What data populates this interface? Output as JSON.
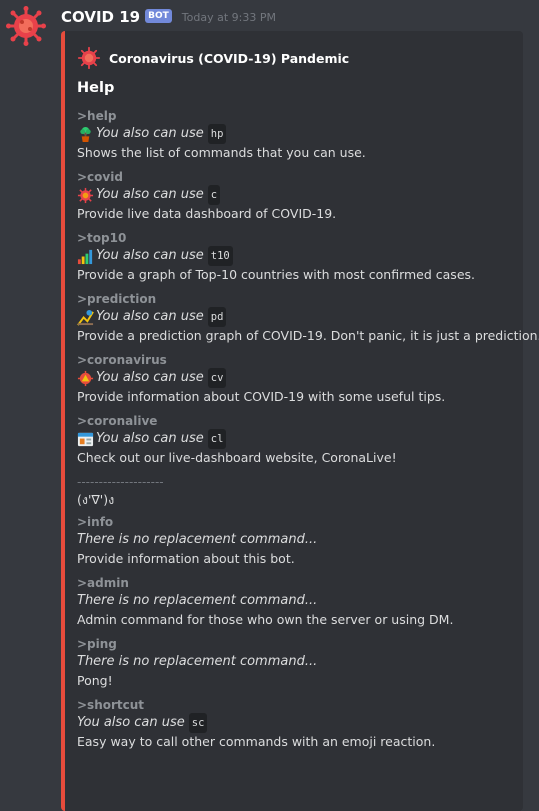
{
  "message": {
    "username": "COVID 19",
    "bot_tag": "BOT",
    "timestamp": "Today at 9:33 PM",
    "avatar_icon": "virus-icon"
  },
  "embed": {
    "accent_color": "#e74c3c",
    "author": "Coronavirus (COVID-19) Pandemic",
    "title": "Help",
    "fields": [
      {
        "name": ">help",
        "alias_text": "You also can use",
        "alias": "hp",
        "icon": "potted-plant-icon",
        "description": "Shows the list of commands that you can use."
      },
      {
        "name": ">covid",
        "alias_text": "You also can use",
        "alias": "c",
        "icon": "virus-icon",
        "description": "Provide live data dashboard of COVID-19."
      },
      {
        "name": ">top10",
        "alias_text": "You also can use",
        "alias": "t10",
        "icon": "bar-chart-icon",
        "description": "Provide a graph of Top-10 countries with most confirmed cases."
      },
      {
        "name": ">prediction",
        "alias_text": "You also can use",
        "alias": "pd",
        "icon": "trend-icon",
        "description": "Provide a prediction graph of COVID-19. Don't panic, it is just a prediction."
      },
      {
        "name": ">coronavirus",
        "alias_text": "You also can use",
        "alias": "cv",
        "icon": "virus-alert-icon",
        "description": "Provide information about COVID-19 with some useful tips."
      },
      {
        "name": ">coronalive",
        "alias_text": "You also can use",
        "alias": "cl",
        "icon": "browser-window-icon",
        "description": "Check out our live-dashboard website, CoronaLive!"
      }
    ],
    "separator": "--------------------",
    "kaomoji": "(ง'∇')ง",
    "other_fields": [
      {
        "name": ">info",
        "note": "There is no replacement command...",
        "description": "Provide information about this bot."
      },
      {
        "name": ">admin",
        "note": "There is no replacement command...",
        "description": "Admin command for those who own the server or using DM."
      },
      {
        "name": ">ping",
        "note": "There is no replacement command...",
        "description": "Pong!"
      },
      {
        "name": ">shortcut",
        "alias_text": "You also can use",
        "alias": "sc",
        "description": "Easy way to call other commands with an emoji reaction."
      }
    ]
  }
}
